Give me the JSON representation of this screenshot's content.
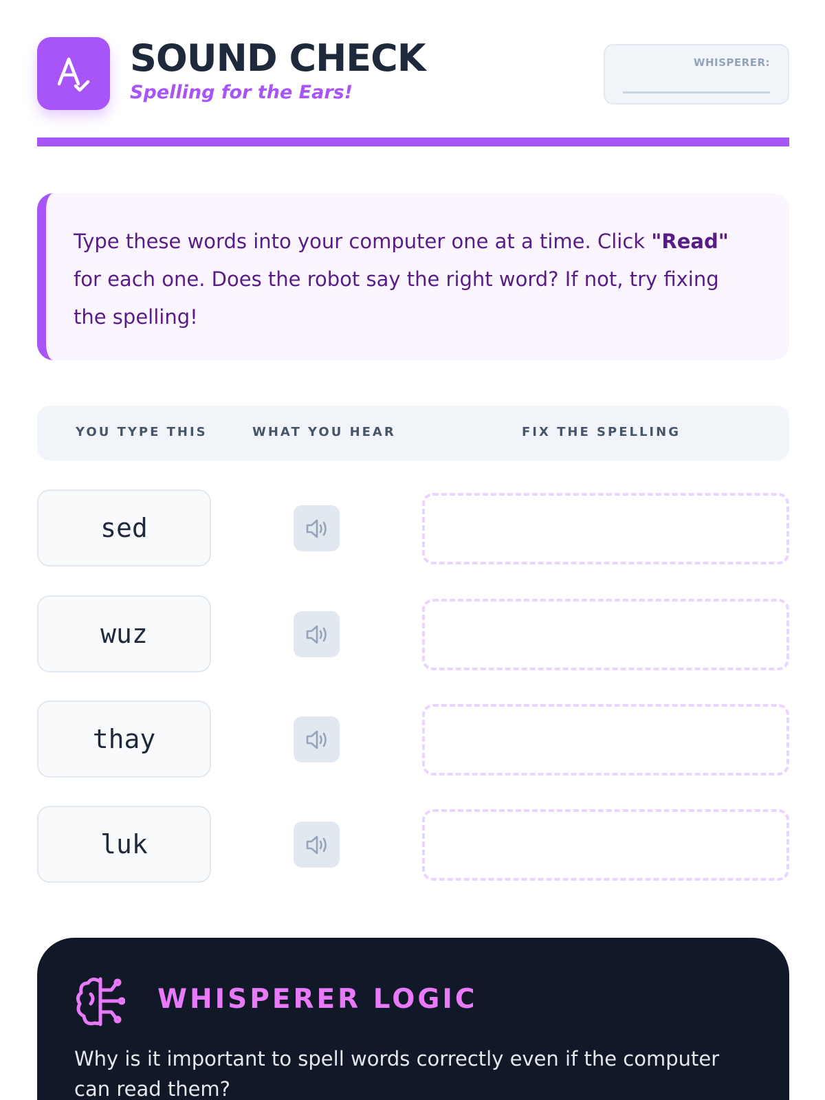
{
  "header": {
    "title": "SOUND CHECK",
    "subtitle": "Spelling for the Ears!",
    "logo_icon": "spell-check-icon",
    "whisperer_label": "WHISPERER:",
    "whisperer_value": ""
  },
  "instructions": {
    "text_before": "Type these words into your computer one at a time. Click ",
    "highlight": "\"Read\"",
    "text_after": " for each one. Does the robot say the right word? If not, try fixing the spelling!"
  },
  "table": {
    "headers": [
      "YOU TYPE THIS",
      "WHAT YOU HEAR",
      "FIX THE SPELLING"
    ],
    "rows": [
      {
        "word": "sed",
        "audio_icon": "speaker-icon",
        "fix_value": ""
      },
      {
        "word": "wuz",
        "audio_icon": "speaker-icon",
        "fix_value": ""
      },
      {
        "word": "thay",
        "audio_icon": "speaker-icon",
        "fix_value": ""
      },
      {
        "word": "luk",
        "audio_icon": "speaker-icon",
        "fix_value": ""
      }
    ]
  },
  "logic": {
    "icon": "brain-icon",
    "title": "WHISPERER LOGIC",
    "text": "Why is it important to spell words correctly even if the computer can read them?"
  },
  "colors": {
    "accent": "#a855f7",
    "accent_dark": "#581c87",
    "panel_dark": "#111827",
    "logic_title": "#e879f9",
    "dashed_border": "#e9d5ff"
  }
}
